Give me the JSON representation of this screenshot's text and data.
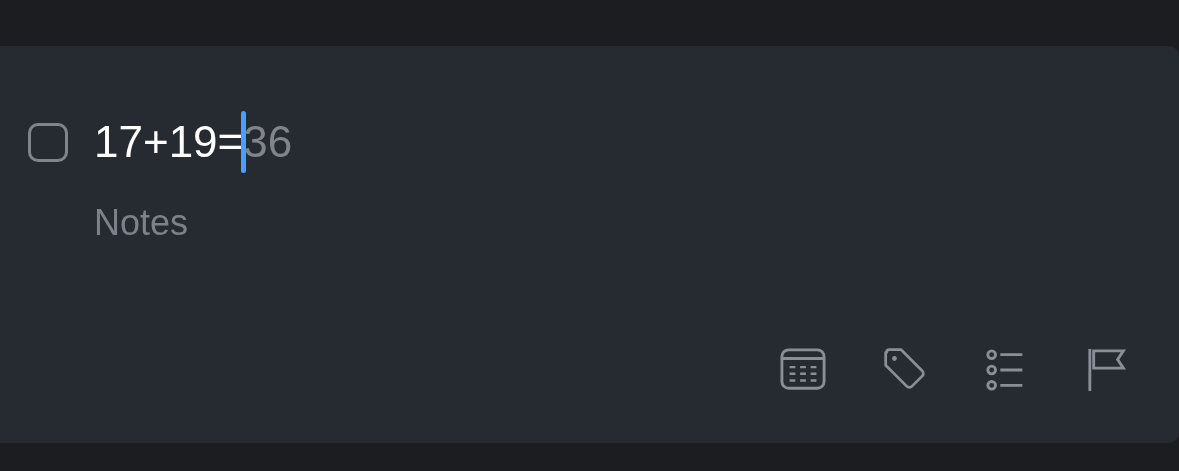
{
  "task": {
    "checked": false,
    "title": "17+19=",
    "suggestion": "36"
  },
  "notes": {
    "placeholder": "Notes"
  }
}
